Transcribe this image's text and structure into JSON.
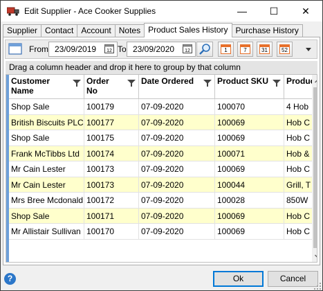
{
  "window": {
    "title": "Edit Supplier - Ace Cooker Supplies",
    "minimize": "—",
    "maximize": "☐",
    "close": "✕"
  },
  "tabs": [
    {
      "label": "Supplier"
    },
    {
      "label": "Contact"
    },
    {
      "label": "Account"
    },
    {
      "label": "Notes"
    },
    {
      "label": "Product Sales History"
    },
    {
      "label": "Purchase History"
    }
  ],
  "active_tab": "Product Sales History",
  "toolbar": {
    "from_label": "From",
    "from_date": "23/09/2019",
    "to_label": "To",
    "to_date": "23/09/2020",
    "period_buttons": [
      "1",
      "7",
      "31",
      "52"
    ]
  },
  "group_panel": {
    "text": "Drag a column header and drop it here to group by that column"
  },
  "grid": {
    "columns": [
      "Customer Name",
      "Order No",
      "Date Ordered",
      "Product SKU",
      "Product"
    ],
    "rows": [
      [
        "Shop Sale",
        "100179",
        "07-09-2020",
        "100070",
        "4 Hob"
      ],
      [
        "British Biscuits PLC",
        "100177",
        "07-09-2020",
        "100069",
        "Hob C"
      ],
      [
        "Shop Sale",
        "100175",
        "07-09-2020",
        "100069",
        "Hob C"
      ],
      [
        "Frank McTibbs Ltd",
        "100174",
        "07-09-2020",
        "100071",
        "Hob &"
      ],
      [
        "Mr Cain Lester",
        "100173",
        "07-09-2020",
        "100069",
        "Hob C"
      ],
      [
        "Mr Cain Lester",
        "100173",
        "07-09-2020",
        "100044",
        "Grill, T"
      ],
      [
        "Mrs Bree Mcdonald",
        "100172",
        "07-09-2020",
        "100028",
        "850W"
      ],
      [
        "Shop Sale",
        "100171",
        "07-09-2020",
        "100069",
        "Hob C"
      ],
      [
        "Mr Allistair Sullivan",
        "100170",
        "07-09-2020",
        "100069",
        "Hob C"
      ]
    ],
    "highlight_color": "#ffffcc"
  },
  "footer": {
    "help": "?",
    "ok_label": "Ok",
    "cancel_label": "Cancel"
  },
  "colors": {
    "accent": "#0078d7",
    "grid_left_bar": "#6fa0d9",
    "period_icon": "#e8702a"
  }
}
